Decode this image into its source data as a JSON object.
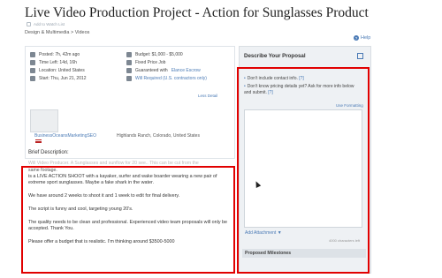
{
  "page": {
    "title": "Live Video Production Project - Action for Sunglasses Product",
    "add_to_watch_list": "Add to Watch List",
    "breadcrumb": "Design & Multimedia > Videos",
    "help_label": "Help"
  },
  "details": {
    "posted": "Posted: 7h, 42m ago",
    "time_left": "Time Left: 14d, 16h",
    "location": "Location: United States",
    "start": "Start: Thu, Jun 21, 2012",
    "budget": "Budget: $1,000 - $5,000",
    "job_type": "Fixed Price Job",
    "guaranteed_prefix": "Guaranteed with",
    "guaranteed_link": "Elance Escrow",
    "will_required": "Will Required (U.S. contractors only)",
    "less_detail": "Less Detail"
  },
  "poster": {
    "name": "BusinessOceansMarketingSEO",
    "location": "Highlands Ranch, Colorado, United States"
  },
  "brief": {
    "label": "Brief Description:",
    "overlap_line": "Will Video Producer. A Sunglasses and sunflow for 20 see.. This can be cut from the",
    "overlap_line2": "same footage.",
    "paragraphs": [
      "is a LIVE ACTION SHOOT with a kayaker, surfer and wake boarder wearing a new pair of extreme sport sunglasses. Maybe a fake shark in the water.",
      "We have around 2 weeks to shoot it and 1 week to edit for final delivery.",
      "The script is funny and cool, targeting young 20's.",
      "The quality needs to be clean and professional. Experienced video team proposals will only be accepted. Thank You.",
      "Please offer a budget that is realistic. I'm thinking around $3500-5000"
    ]
  },
  "proposal": {
    "title": "Describe Your Proposal",
    "bullet1_text": "Don't include contact info.",
    "bullet1_link": "[?]",
    "bullet2_text": "Don't know pricing details yet? Ask for more info below and submit.",
    "bullet2_link": "[?]",
    "use_formatting": "Use Formatting",
    "add_attachment": "Add Attachment ▼",
    "char_count": "4000 characters left",
    "milestones_label": "Proposed Milestones"
  }
}
